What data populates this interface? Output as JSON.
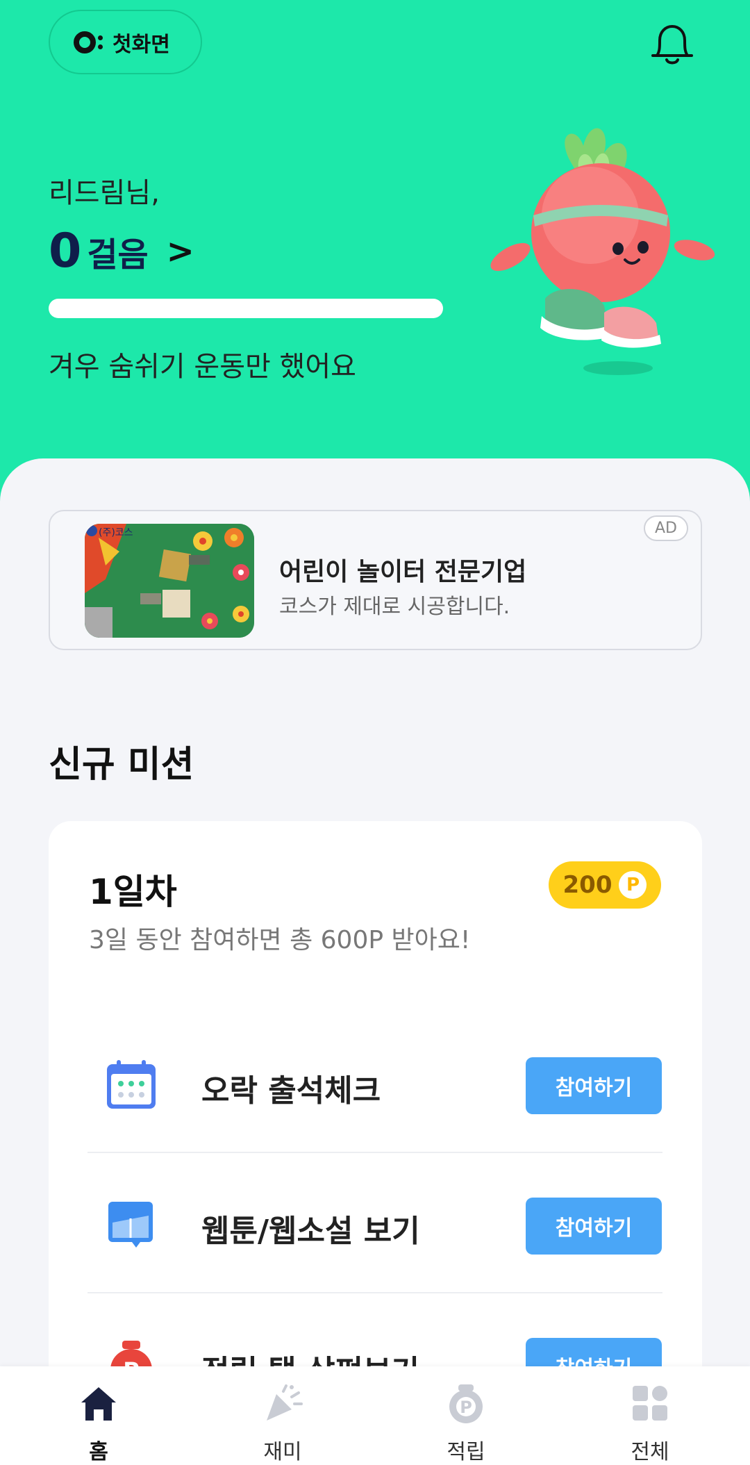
{
  "header": {
    "home_label": "첫화면",
    "greeting": "리드림님,",
    "steps_value": "0",
    "steps_unit": "걸음",
    "steps_progress": 0,
    "status_text": "겨우 숨쉬기 운동만 했어요"
  },
  "icons": {
    "logo": "ocoin-logo-icon",
    "notification": "bell-icon",
    "mascot": "radish-mascot-illustration"
  },
  "ad": {
    "badge": "AD",
    "title": "어린이 놀이터 전문기업",
    "subtitle": "코스가 제대로 시공합니다.",
    "image_text": "(주)코스"
  },
  "missions": {
    "section_title": "신규 미션",
    "day_title": "1일차",
    "day_subtitle": "3일 동안 참여하면 총 600P 받아요!",
    "points": "200",
    "point_unit": "P",
    "items": [
      {
        "label": "오락 출석체크",
        "button": "참여하기",
        "icon": "calendar-icon"
      },
      {
        "label": "웹툰/웹소설 보기",
        "button": "참여하기",
        "icon": "webtoon-icon"
      },
      {
        "label": "적립 탭 살펴보기",
        "button": "참여하기",
        "icon": "money-bag-icon"
      }
    ]
  },
  "bottom_nav": {
    "items": [
      {
        "label": "홈",
        "icon": "home-icon",
        "active": true
      },
      {
        "label": "재미",
        "icon": "party-popper-icon",
        "active": false
      },
      {
        "label": "적립",
        "icon": "point-pouch-icon",
        "active": false
      },
      {
        "label": "전체",
        "icon": "grid-icon",
        "active": false
      }
    ]
  },
  "colors": {
    "header_bg": "#1de8aa",
    "accent_blue": "#4aa6f7",
    "point_yellow": "#ffcf1a",
    "text_navy": "#0f1f4a"
  }
}
